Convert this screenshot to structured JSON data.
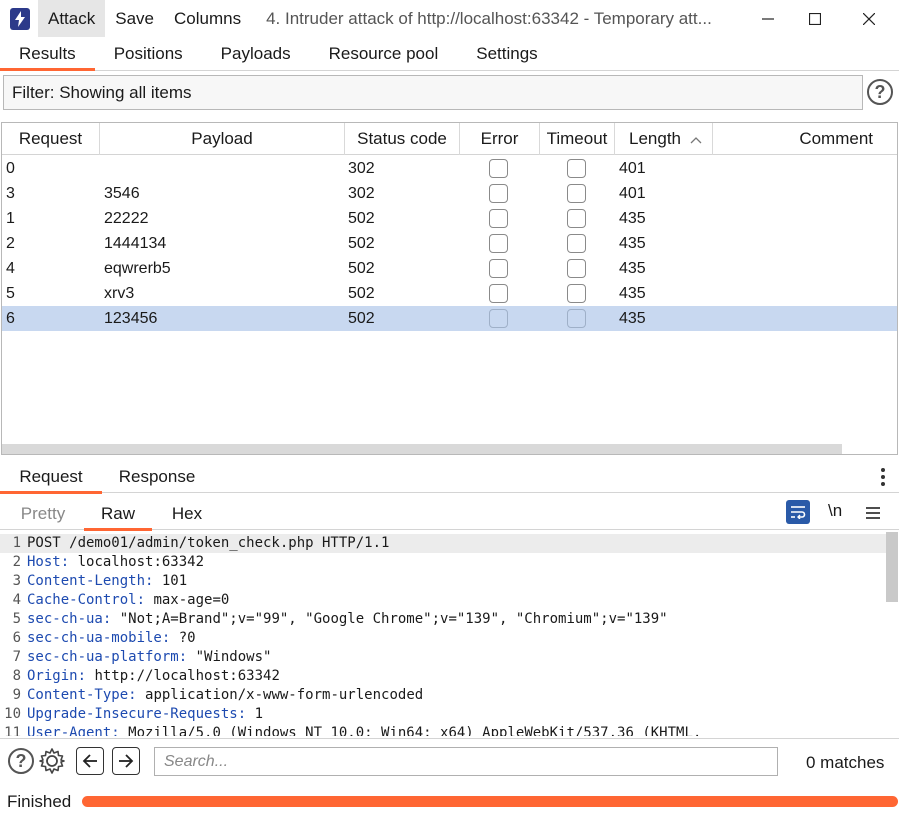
{
  "menu": {
    "attack": "Attack",
    "save": "Save",
    "columns": "Columns"
  },
  "window": {
    "title": "4. Intruder attack of http://localhost:63342 - Temporary att..."
  },
  "main_tabs": [
    "Results",
    "Positions",
    "Payloads",
    "Resource pool",
    "Settings"
  ],
  "filter": {
    "text": "Filter: Showing all items"
  },
  "table": {
    "columns": [
      "Request",
      "Payload",
      "Status code",
      "Error",
      "Timeout",
      "Length",
      "Comment"
    ],
    "rows": [
      {
        "request": "0",
        "payload": "",
        "status": "302",
        "length": "401"
      },
      {
        "request": "3",
        "payload": "3546",
        "status": "302",
        "length": "401"
      },
      {
        "request": "1",
        "payload": "22222",
        "status": "502",
        "length": "435"
      },
      {
        "request": "2",
        "payload": "1444134",
        "status": "502",
        "length": "435"
      },
      {
        "request": "4",
        "payload": "eqwrerb5",
        "status": "502",
        "length": "435"
      },
      {
        "request": "5",
        "payload": "xrv3",
        "status": "502",
        "length": "435"
      },
      {
        "request": "6",
        "payload": "123456",
        "status": "502",
        "length": "435"
      }
    ]
  },
  "detail_tabs": [
    "Request",
    "Response"
  ],
  "view_tabs": [
    "Pretty",
    "Raw",
    "Hex"
  ],
  "toolbar": {
    "newline_label": "\\n"
  },
  "request_lines": [
    {
      "n": "1",
      "key": "",
      "val": "POST /demo01/admin/token_check.php HTTP/1.1"
    },
    {
      "n": "2",
      "key": "Host",
      "val": " localhost:63342"
    },
    {
      "n": "3",
      "key": "Content-Length",
      "val": " 101"
    },
    {
      "n": "4",
      "key": "Cache-Control",
      "val": " max-age=0"
    },
    {
      "n": "5",
      "key": "sec-ch-ua",
      "val": " \"Not;A=Brand\";v=\"99\", \"Google Chrome\";v=\"139\", \"Chromium\";v=\"139\""
    },
    {
      "n": "6",
      "key": "sec-ch-ua-mobile",
      "val": " ?0"
    },
    {
      "n": "7",
      "key": "sec-ch-ua-platform",
      "val": " \"Windows\""
    },
    {
      "n": "8",
      "key": "Origin",
      "val": " http://localhost:63342"
    },
    {
      "n": "9",
      "key": "Content-Type",
      "val": " application/x-www-form-urlencoded"
    },
    {
      "n": "10",
      "key": "Upgrade-Insecure-Requests",
      "val": " 1"
    },
    {
      "n": "11",
      "key": "User-Agent",
      "val": " Mozilla/5.0 (Windows NT 10.0; Win64; x64) AppleWebKit/537.36 (KHTML,"
    }
  ],
  "search": {
    "placeholder": "Search...",
    "matches": "0 matches"
  },
  "status": {
    "text": "Finished",
    "progress": 1.0
  },
  "colors": {
    "accent": "#ff6633",
    "selection": "#c8d8f0",
    "header_key": "#1d4ab0",
    "app_icon": "#2c3a8a"
  }
}
